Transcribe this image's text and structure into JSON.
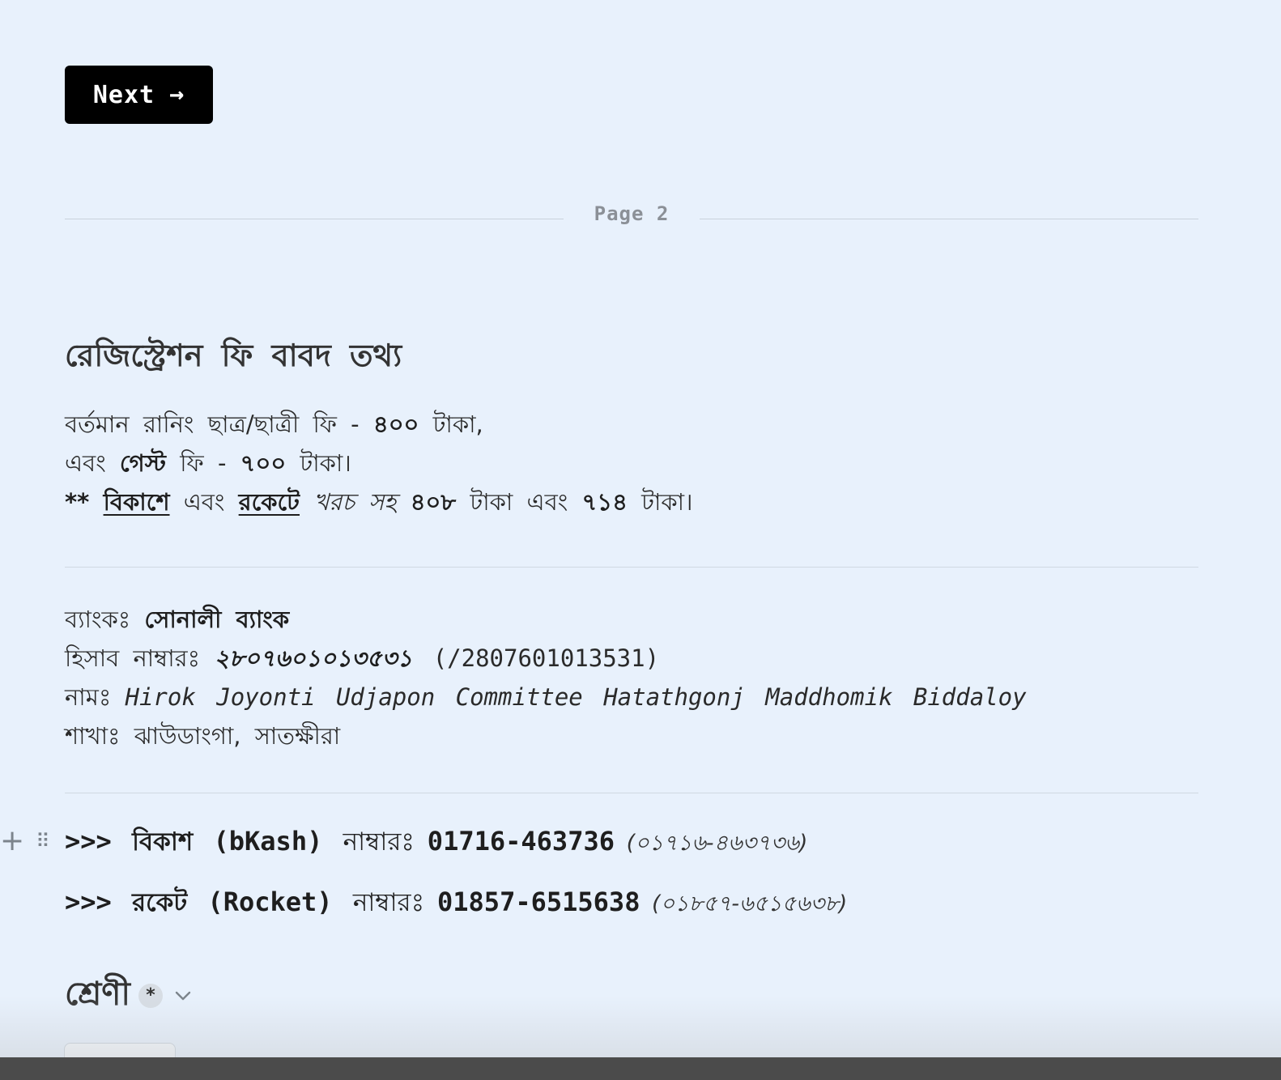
{
  "next_button": {
    "label": "Next",
    "arrow": "→"
  },
  "page_divider": {
    "label": "Page 2"
  },
  "fee_section": {
    "title": "রেজিস্ট্রেশন ফি বাবদ তথ্য",
    "line1": {
      "prefix": "বর্তমান রানিং ছাত্র/ছাত্রী ফি - ",
      "amount": "৪০০",
      "suffix": " টাকা,"
    },
    "line2": {
      "prefix": "এবং ",
      "guest": "গেস্ট",
      "middle": " ফি - ",
      "amount": "৭০০",
      "suffix": " টাকা।"
    },
    "line3": {
      "stars": "**",
      "bkash": "বিকাশে",
      "and1": " এবং ",
      "rocket": "রকেটে",
      "cost_note": " খরচ সহ ",
      "amount1": "৪০৮",
      "mid": " টাকা এবং ",
      "amount2": "৭১৪",
      "suffix": " টাকা।"
    }
  },
  "bank_section": {
    "bank_label": "ব্যাংকঃ ",
    "bank_name": "সোনালী ব্যাংক",
    "account_label": "হিসাব নাম্বারঃ ",
    "account_bn": "২৮০৭৬০১০১৩৫৩১",
    "account_en": " (/2807601013531)",
    "name_label": "নামঃ ",
    "name_value": "Hirok Joyonti Udjapon Committee Hatathgonj Maddhomik Biddaloy",
    "branch_label": "শাখাঃ ",
    "branch_value": "ঝাউডাংগা, সাতক্ষীরা"
  },
  "payment_numbers": {
    "bkash": {
      "prefix": ">>> ",
      "name": "বিকাশ",
      "latin": " (bKash) ",
      "label": "নাম্বারঃ ",
      "number": "01716-463736",
      "number_bn": " (০১৭১৬-৪৬৩৭৩৬)"
    },
    "rocket": {
      "prefix": ">>> ",
      "name": "রকেট",
      "latin": " (Rocket) ",
      "label": "নাম্বারঃ ",
      "number": "01857-6515638",
      "number_bn": " (০১৮৫৭-৬৫১৫৬৩৮)"
    },
    "row_handle": {
      "plus": "+",
      "grip": "⠿"
    }
  },
  "class_question": {
    "label": "শ্রেণী",
    "required_marker": "*"
  },
  "icons": {
    "next": "arrow-right-icon",
    "add": "plus-icon",
    "drag": "drag-handle-icon",
    "expand": "chevron-down-icon"
  },
  "colors": {
    "background": "#e8f1fc",
    "button": "#000000",
    "button_text": "#ffffff",
    "divider": "#cfd8e2",
    "muted": "#8b9097"
  }
}
